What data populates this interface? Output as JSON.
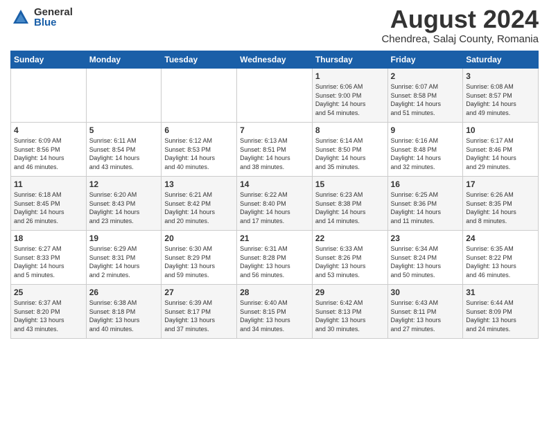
{
  "header": {
    "logo_general": "General",
    "logo_blue": "Blue",
    "month_title": "August 2024",
    "location": "Chendrea, Salaj County, Romania"
  },
  "days_of_week": [
    "Sunday",
    "Monday",
    "Tuesday",
    "Wednesday",
    "Thursday",
    "Friday",
    "Saturday"
  ],
  "weeks": [
    [
      {
        "day": "",
        "info": ""
      },
      {
        "day": "",
        "info": ""
      },
      {
        "day": "",
        "info": ""
      },
      {
        "day": "",
        "info": ""
      },
      {
        "day": "1",
        "info": "Sunrise: 6:06 AM\nSunset: 9:00 PM\nDaylight: 14 hours\nand 54 minutes."
      },
      {
        "day": "2",
        "info": "Sunrise: 6:07 AM\nSunset: 8:58 PM\nDaylight: 14 hours\nand 51 minutes."
      },
      {
        "day": "3",
        "info": "Sunrise: 6:08 AM\nSunset: 8:57 PM\nDaylight: 14 hours\nand 49 minutes."
      }
    ],
    [
      {
        "day": "4",
        "info": "Sunrise: 6:09 AM\nSunset: 8:56 PM\nDaylight: 14 hours\nand 46 minutes."
      },
      {
        "day": "5",
        "info": "Sunrise: 6:11 AM\nSunset: 8:54 PM\nDaylight: 14 hours\nand 43 minutes."
      },
      {
        "day": "6",
        "info": "Sunrise: 6:12 AM\nSunset: 8:53 PM\nDaylight: 14 hours\nand 40 minutes."
      },
      {
        "day": "7",
        "info": "Sunrise: 6:13 AM\nSunset: 8:51 PM\nDaylight: 14 hours\nand 38 minutes."
      },
      {
        "day": "8",
        "info": "Sunrise: 6:14 AM\nSunset: 8:50 PM\nDaylight: 14 hours\nand 35 minutes."
      },
      {
        "day": "9",
        "info": "Sunrise: 6:16 AM\nSunset: 8:48 PM\nDaylight: 14 hours\nand 32 minutes."
      },
      {
        "day": "10",
        "info": "Sunrise: 6:17 AM\nSunset: 8:46 PM\nDaylight: 14 hours\nand 29 minutes."
      }
    ],
    [
      {
        "day": "11",
        "info": "Sunrise: 6:18 AM\nSunset: 8:45 PM\nDaylight: 14 hours\nand 26 minutes."
      },
      {
        "day": "12",
        "info": "Sunrise: 6:20 AM\nSunset: 8:43 PM\nDaylight: 14 hours\nand 23 minutes."
      },
      {
        "day": "13",
        "info": "Sunrise: 6:21 AM\nSunset: 8:42 PM\nDaylight: 14 hours\nand 20 minutes."
      },
      {
        "day": "14",
        "info": "Sunrise: 6:22 AM\nSunset: 8:40 PM\nDaylight: 14 hours\nand 17 minutes."
      },
      {
        "day": "15",
        "info": "Sunrise: 6:23 AM\nSunset: 8:38 PM\nDaylight: 14 hours\nand 14 minutes."
      },
      {
        "day": "16",
        "info": "Sunrise: 6:25 AM\nSunset: 8:36 PM\nDaylight: 14 hours\nand 11 minutes."
      },
      {
        "day": "17",
        "info": "Sunrise: 6:26 AM\nSunset: 8:35 PM\nDaylight: 14 hours\nand 8 minutes."
      }
    ],
    [
      {
        "day": "18",
        "info": "Sunrise: 6:27 AM\nSunset: 8:33 PM\nDaylight: 14 hours\nand 5 minutes."
      },
      {
        "day": "19",
        "info": "Sunrise: 6:29 AM\nSunset: 8:31 PM\nDaylight: 14 hours\nand 2 minutes."
      },
      {
        "day": "20",
        "info": "Sunrise: 6:30 AM\nSunset: 8:29 PM\nDaylight: 13 hours\nand 59 minutes."
      },
      {
        "day": "21",
        "info": "Sunrise: 6:31 AM\nSunset: 8:28 PM\nDaylight: 13 hours\nand 56 minutes."
      },
      {
        "day": "22",
        "info": "Sunrise: 6:33 AM\nSunset: 8:26 PM\nDaylight: 13 hours\nand 53 minutes."
      },
      {
        "day": "23",
        "info": "Sunrise: 6:34 AM\nSunset: 8:24 PM\nDaylight: 13 hours\nand 50 minutes."
      },
      {
        "day": "24",
        "info": "Sunrise: 6:35 AM\nSunset: 8:22 PM\nDaylight: 13 hours\nand 46 minutes."
      }
    ],
    [
      {
        "day": "25",
        "info": "Sunrise: 6:37 AM\nSunset: 8:20 PM\nDaylight: 13 hours\nand 43 minutes."
      },
      {
        "day": "26",
        "info": "Sunrise: 6:38 AM\nSunset: 8:18 PM\nDaylight: 13 hours\nand 40 minutes."
      },
      {
        "day": "27",
        "info": "Sunrise: 6:39 AM\nSunset: 8:17 PM\nDaylight: 13 hours\nand 37 minutes."
      },
      {
        "day": "28",
        "info": "Sunrise: 6:40 AM\nSunset: 8:15 PM\nDaylight: 13 hours\nand 34 minutes."
      },
      {
        "day": "29",
        "info": "Sunrise: 6:42 AM\nSunset: 8:13 PM\nDaylight: 13 hours\nand 30 minutes."
      },
      {
        "day": "30",
        "info": "Sunrise: 6:43 AM\nSunset: 8:11 PM\nDaylight: 13 hours\nand 27 minutes."
      },
      {
        "day": "31",
        "info": "Sunrise: 6:44 AM\nSunset: 8:09 PM\nDaylight: 13 hours\nand 24 minutes."
      }
    ]
  ]
}
